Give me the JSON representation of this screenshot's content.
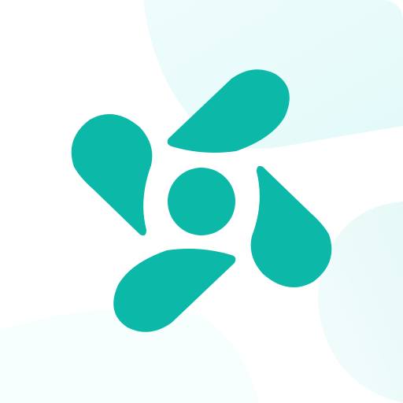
{
  "colors": {
    "background": "#ffffff",
    "accent": "#0cb9a8",
    "background_tint": "#e8fbfb"
  },
  "icon": {
    "name": "fan-icon",
    "blade_count": 4
  }
}
